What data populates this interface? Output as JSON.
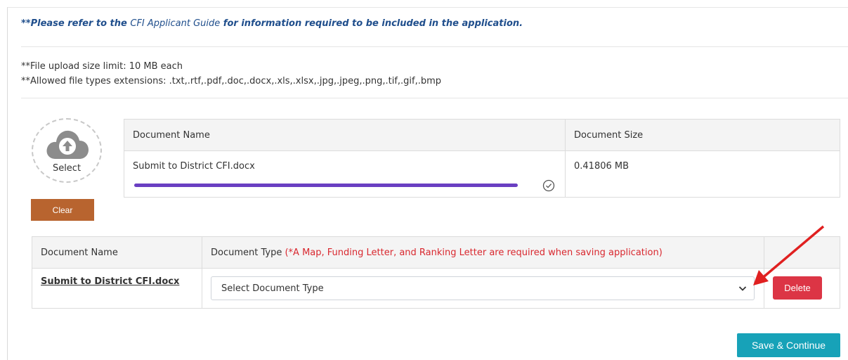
{
  "guide": {
    "prefix": "**Please refer to the ",
    "link": "CFI Applicant Guide",
    "suffix": " for information required to be included in the application."
  },
  "limits": {
    "size": "**File upload size limit: 10 MB each",
    "types": "**Allowed file types extensions: .txt,.rtf,.pdf,.doc,.docx,.xls,.xlsx,.jpg,.jpeg,.png,.tif,.gif,.bmp"
  },
  "upload": {
    "select_label": "Select",
    "clear_label": "Clear",
    "upload_icon": "cloud-upload-icon",
    "headers": {
      "name": "Document Name",
      "size": "Document Size"
    },
    "file": {
      "name": "Submit to District CFI.docx",
      "size": "0.41806 MB",
      "progress": 1.0,
      "status_icon": "check-circle-icon"
    }
  },
  "doc_table": {
    "headers": {
      "name": "Document Name",
      "type": "Document Type",
      "type_note": "(*A Map, Funding Letter, and Ranking Letter are required when saving application)"
    },
    "row": {
      "name": "Submit to District CFI.docx",
      "type_value": "Select Document Type",
      "delete_label": "Delete"
    }
  },
  "save_label": "Save & Continue",
  "colors": {
    "guide_text": "#1f4e8c",
    "clear_button": "#b8642f",
    "progress": "#6a3fc2",
    "required_note": "#d9282f",
    "delete_button": "#dc3545",
    "save_button": "#17a2b8",
    "annotation_arrow": "#e02020"
  }
}
